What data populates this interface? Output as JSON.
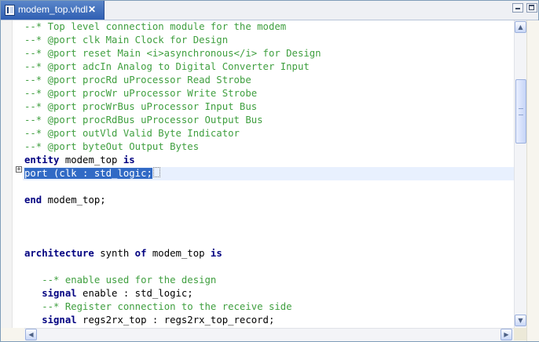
{
  "tab": {
    "title": "modem_top.vhdl",
    "close_glyph": "✕",
    "icon": "vhdl-file-icon"
  },
  "window_buttons": {
    "minimize": "minimize-icon",
    "maximize": "maximize-icon"
  },
  "editor": {
    "lines": [
      {
        "parts": [
          {
            "t": "--* Top level connection module for the modem",
            "c": "comment"
          }
        ]
      },
      {
        "parts": [
          {
            "t": "--* @port clk Main Clock for Design",
            "c": "comment"
          }
        ]
      },
      {
        "parts": [
          {
            "t": "--* @port reset Main <i>asynchronous</i> for Design",
            "c": "comment"
          }
        ]
      },
      {
        "parts": [
          {
            "t": "--* @port adcIn Analog to Digital Converter Input",
            "c": "comment"
          }
        ]
      },
      {
        "parts": [
          {
            "t": "--* @port procRd uProcessor Read Strobe",
            "c": "comment"
          }
        ]
      },
      {
        "parts": [
          {
            "t": "--* @port procWr uProcessor Write Strobe",
            "c": "comment"
          }
        ]
      },
      {
        "parts": [
          {
            "t": "--* @port procWrBus uProcessor Input Bus",
            "c": "comment"
          }
        ]
      },
      {
        "parts": [
          {
            "t": "--* @port procRdBus uProcessor Output Bus",
            "c": "comment"
          }
        ]
      },
      {
        "parts": [
          {
            "t": "--* @port outVld Valid Byte Indicator",
            "c": "comment"
          }
        ]
      },
      {
        "parts": [
          {
            "t": "--* @port byteOut Output Bytes",
            "c": "comment"
          }
        ]
      },
      {
        "parts": [
          {
            "t": "entity",
            "c": "kw"
          },
          {
            "t": " modem_top "
          },
          {
            "t": "is",
            "c": "kw"
          }
        ]
      },
      {
        "current": true,
        "folded": true,
        "parts": [
          {
            "t": "port (clk : std_logic;",
            "c": "sel"
          }
        ]
      },
      {
        "parts": []
      },
      {
        "parts": [
          {
            "t": "end",
            "c": "kw"
          },
          {
            "t": " modem_top;"
          }
        ]
      },
      {
        "parts": []
      },
      {
        "parts": []
      },
      {
        "parts": []
      },
      {
        "parts": [
          {
            "t": "architecture",
            "c": "kw"
          },
          {
            "t": " synth "
          },
          {
            "t": "of",
            "c": "kw"
          },
          {
            "t": " modem_top "
          },
          {
            "t": "is",
            "c": "kw"
          }
        ]
      },
      {
        "parts": []
      },
      {
        "parts": [
          {
            "t": "   "
          },
          {
            "t": "--* enable used for the design",
            "c": "comment"
          }
        ]
      },
      {
        "parts": [
          {
            "t": "   "
          },
          {
            "t": "signal",
            "c": "kw"
          },
          {
            "t": " enable : std_logic;"
          }
        ]
      },
      {
        "parts": [
          {
            "t": "   "
          },
          {
            "t": "--* Register connection to the receive side",
            "c": "comment"
          }
        ]
      },
      {
        "parts": [
          {
            "t": "   "
          },
          {
            "t": "signal",
            "c": "kw"
          },
          {
            "t": " regs2rx_top : regs2rx_top_record;"
          }
        ]
      }
    ]
  },
  "scrollbar": {
    "up_glyph": "▲",
    "down_glyph": "▼",
    "left_glyph": "◀",
    "right_glyph": "▶",
    "thumb_icon": "scroll-grip-icon"
  }
}
